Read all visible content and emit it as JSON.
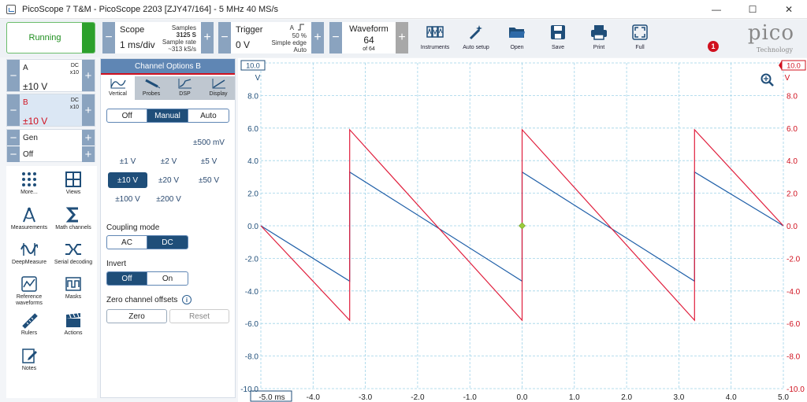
{
  "window": {
    "title": "PicoScope 7 T&M  - PicoScope 2203 [ZJY47/164] - 5 MHz 40 MS/s",
    "controls": [
      "—",
      "☐",
      "✕"
    ]
  },
  "toolbar": {
    "run_label": "Running",
    "scope": {
      "title": "Scope",
      "value": "1 ms/div",
      "samples_label": "Samples",
      "samples": "3125 S",
      "rate_label": "Sample rate",
      "rate": "~313 kS/s"
    },
    "trigger": {
      "title": "Trigger",
      "value": "0 V",
      "channel": "A",
      "percent": "50 %",
      "type": "Simple edge",
      "mode": "Auto"
    },
    "waveform": {
      "title": "Waveform",
      "value": "64",
      "of": "of 64"
    },
    "buttons": [
      {
        "name": "instruments",
        "label": "Instruments"
      },
      {
        "name": "auto-setup",
        "label": "Auto setup"
      },
      {
        "name": "open",
        "label": "Open"
      },
      {
        "name": "save",
        "label": "Save"
      },
      {
        "name": "print",
        "label": "Print"
      },
      {
        "name": "full",
        "label": "Full"
      }
    ],
    "notification_count": "1",
    "logo_word": "pico",
    "logo_sub": "Technology"
  },
  "channels": {
    "a": {
      "name": "A",
      "coupling": "DC",
      "probe": "x10",
      "range": "±10 V"
    },
    "b": {
      "name": "B",
      "coupling": "DC",
      "probe": "x10",
      "range": "±10 V"
    },
    "gen": {
      "name": "Gen",
      "state": "Off"
    }
  },
  "tools": [
    {
      "label": "More..."
    },
    {
      "label": "Views"
    },
    {
      "label": "Measurements"
    },
    {
      "label": "Math channels"
    },
    {
      "label": "DeepMeasure"
    },
    {
      "label": "Serial decoding"
    },
    {
      "label": "Reference waveforms"
    },
    {
      "label": "Masks"
    },
    {
      "label": "Rulers"
    },
    {
      "label": "Actions"
    },
    {
      "label": "Notes"
    }
  ],
  "options": {
    "header": "Channel Options  B",
    "tabs": [
      "Vertical",
      "Probes",
      "DSP",
      "Display"
    ],
    "range_mode": [
      "Off",
      "Manual",
      "Auto"
    ],
    "ranges": [
      "±500 mV",
      "±1 V",
      "±2 V",
      "±5 V",
      "±10 V",
      "±20 V",
      "±50 V",
      "±100 V",
      "±200 V"
    ],
    "coupling_label": "Coupling mode",
    "coupling": [
      "AC",
      "DC"
    ],
    "invert_label": "Invert",
    "invert": [
      "Off",
      "On"
    ],
    "zero_label": "Zero channel offsets",
    "zero_btn": "Zero",
    "reset_btn": "Reset"
  },
  "axes": {
    "left_badge": "10.0",
    "right_badge": "10.0",
    "unit": "V",
    "y_ticks": [
      "8.0",
      "6.0",
      "4.0",
      "2.0",
      "0.0",
      "-2.0",
      "-4.0",
      "-6.0",
      "-8.0",
      "-10.0"
    ],
    "x_ticks": [
      "-5.0 ms",
      "-4.0",
      "-3.0",
      "-2.0",
      "-1.0",
      "0.0",
      "1.0",
      "2.0",
      "3.0",
      "4.0",
      "5.0"
    ]
  },
  "colors": {
    "channel_a": "#1f5fa8",
    "channel_b": "#e01e3c",
    "accent": "#1f4e79",
    "running": "#2ca02c"
  },
  "chart_data": {
    "type": "line",
    "x_unit": "ms",
    "xlim": [
      -5,
      5
    ],
    "ylim": [
      -10,
      10
    ],
    "grid": true,
    "series": [
      {
        "name": "A",
        "color": "#1f5fa8",
        "x": [
          -5.0,
          -3.3,
          -3.3,
          0.0,
          0.0,
          3.3,
          3.3,
          5.0
        ],
        "y": [
          0.0,
          -3.4,
          3.3,
          -3.4,
          3.3,
          -3.4,
          3.3,
          0.0
        ]
      },
      {
        "name": "B",
        "color": "#e01e3c",
        "x": [
          -5.0,
          -3.3,
          -3.3,
          0.0,
          0.0,
          3.3,
          3.3,
          5.0
        ],
        "y": [
          0.0,
          -5.8,
          5.9,
          -5.8,
          5.9,
          -5.8,
          5.9,
          0.0
        ]
      }
    ],
    "trigger_point": {
      "x": 0.0,
      "y": 0.0
    }
  }
}
